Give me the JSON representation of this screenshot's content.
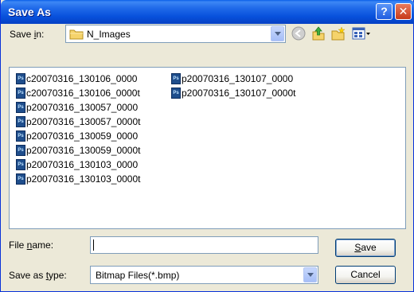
{
  "window": {
    "title": "Save As"
  },
  "titlebar": {
    "help_glyph": "?",
    "close_glyph": "✕"
  },
  "location": {
    "label_pre": "Save ",
    "label_hot": "i",
    "label_post": "n:",
    "value": "N_Images"
  },
  "files": [
    "c20070316_130106_0000",
    "c20070316_130106_0000t",
    "p20070316_130057_0000",
    "p20070316_130057_0000t",
    "p20070316_130059_0000",
    "p20070316_130059_0000t",
    "p20070316_130103_0000",
    "p20070316_130103_0000t",
    "p20070316_130107_0000",
    "p20070316_130107_0000t"
  ],
  "file_icon_text": "Ps",
  "filename": {
    "label_pre": "File ",
    "label_hot": "n",
    "label_post": "ame:",
    "value": ""
  },
  "savetype": {
    "label_pre": "Save as ",
    "label_hot": "t",
    "label_post": "ype:",
    "value": "Bitmap Files(*.bmp)"
  },
  "buttons": {
    "save_hot": "S",
    "save_rest": "ave",
    "cancel": "Cancel"
  },
  "colors": {
    "titlebar": "#0A5FE8",
    "dialog_bg": "#ECE9D8",
    "field_border": "#7F9DB9"
  }
}
